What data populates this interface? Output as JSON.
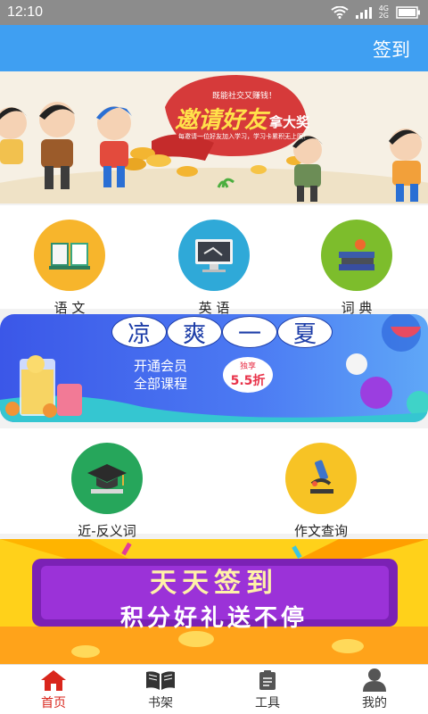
{
  "status": {
    "time": "12:10",
    "net_top": "4G",
    "net_bottom": "2G"
  },
  "header": {
    "signin_label": "签到"
  },
  "banner_invite": {
    "title": "邀请好友",
    "suffix": "拿大奖",
    "tag": "既能社交又赚钱！",
    "line": "每邀请一位好友加入学习，学习卡累积无上限！"
  },
  "categories_top": [
    {
      "label": "语 文",
      "icon": "book-icon",
      "color": "#f7b52c"
    },
    {
      "label": "英 语",
      "icon": "monitor-icon",
      "color": "#2fa9d8"
    },
    {
      "label": "词 典",
      "icon": "books-icon",
      "color": "#7dbd2c"
    }
  ],
  "banner_summer": {
    "title_chars": [
      "凉",
      "爽",
      "一",
      "夏"
    ],
    "line1": "开通会员",
    "line2": "全部课程",
    "badge_top": "独享",
    "badge_value": "5.5折"
  },
  "categories_bottom": [
    {
      "label": "近-反义词",
      "icon": "graduation-cap-icon",
      "color": "#26a65b"
    },
    {
      "label": "作文查询",
      "icon": "microscope-icon",
      "color": "#f7c325"
    }
  ],
  "banner_checkin": {
    "line1": "天天签到",
    "line2": "积分好礼送不停"
  },
  "tabs": [
    {
      "label": "首页",
      "icon": "home-icon",
      "active": true
    },
    {
      "label": "书架",
      "icon": "bookshelf-icon",
      "active": false
    },
    {
      "label": "工具",
      "icon": "clipboard-icon",
      "active": false
    },
    {
      "label": "我的",
      "icon": "user-icon",
      "active": false
    }
  ],
  "colors": {
    "appbar": "#3f9ff2",
    "active_tab": "#d9261c"
  }
}
